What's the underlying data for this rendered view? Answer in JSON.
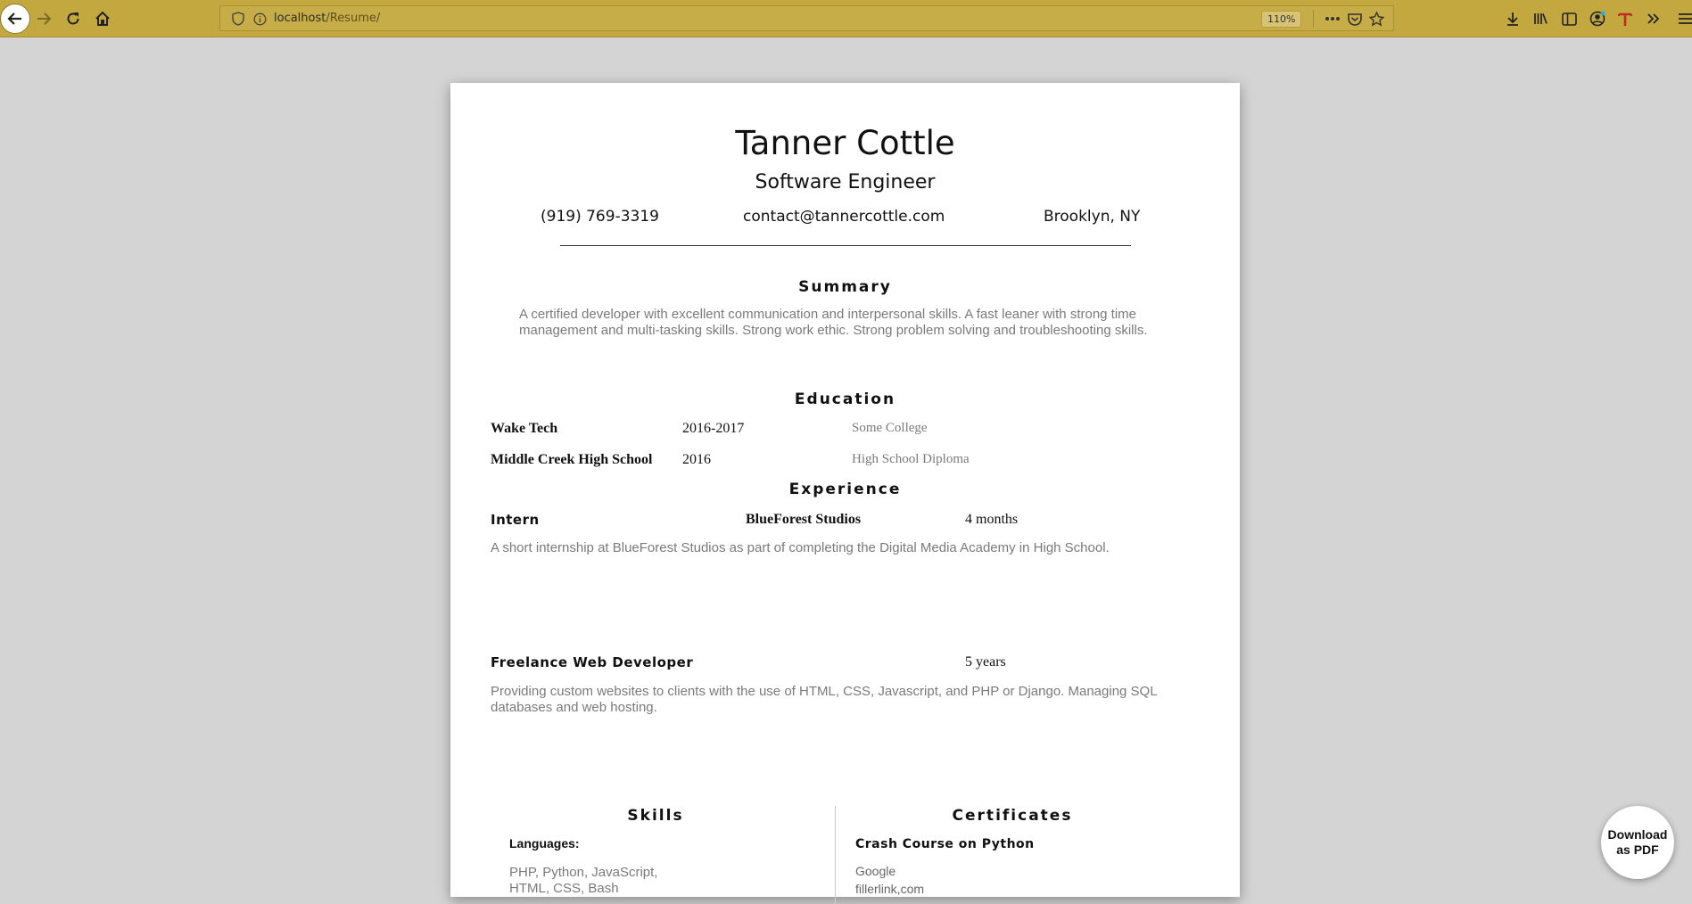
{
  "browser": {
    "url_host": "localhost",
    "url_path": "/Resume/",
    "zoom": "110%"
  },
  "resume": {
    "name": "Tanner Cottle",
    "role": "Software Engineer",
    "phone": "(919) 769-3319",
    "email": "contact@tannercottle.com",
    "location": "Brooklyn, NY",
    "summary": {
      "title": "Summary",
      "text": "A certified developer with excellent communication and interpersonal skills. A fast leaner with strong time management and multi-tasking skills. Strong work ethic. Strong problem solving and troubleshooting skills."
    },
    "education": {
      "title": "Education",
      "items": [
        {
          "school": "Wake Tech",
          "years": "2016-2017",
          "degree": "Some College"
        },
        {
          "school": "Middle Creek High School",
          "years": "2016",
          "degree": "High School Diploma"
        }
      ]
    },
    "experience": {
      "title": "Experience",
      "items": [
        {
          "title": "Intern",
          "company": "BlueForest Studios",
          "duration": "4 months",
          "description": "A short internship at BlueForest Studios as part of completing the Digital Media Academy in High School."
        },
        {
          "title": "Freelance Web Developer",
          "company": "",
          "duration": "5 years",
          "description": "Providing custom websites to clients with the use of HTML, CSS, Javascript, and PHP or Django. Managing SQL databases and web hosting."
        }
      ]
    },
    "skills": {
      "title": "Skills",
      "label": "Languages:",
      "languages_line1": "PHP, Python, JavaScript,",
      "languages_line2": "HTML, CSS, Bash"
    },
    "certificates": {
      "title": "Certificates",
      "items": [
        {
          "name": "Crash Course on Python",
          "issuer": "Google",
          "link": "fillerlink,com"
        }
      ]
    }
  },
  "pdf_button": {
    "line1": "Download",
    "line2": "as PDF"
  },
  "icons": [
    "back-arrow-icon",
    "forward-arrow-icon",
    "reload-icon",
    "home-icon",
    "shield-icon",
    "info-icon",
    "more-icon",
    "pocket-icon",
    "star-icon",
    "download-icon",
    "library-icon",
    "sidebar-icon",
    "account-icon",
    "extension-t-icon",
    "overflow-icon",
    "menu-icon"
  ]
}
